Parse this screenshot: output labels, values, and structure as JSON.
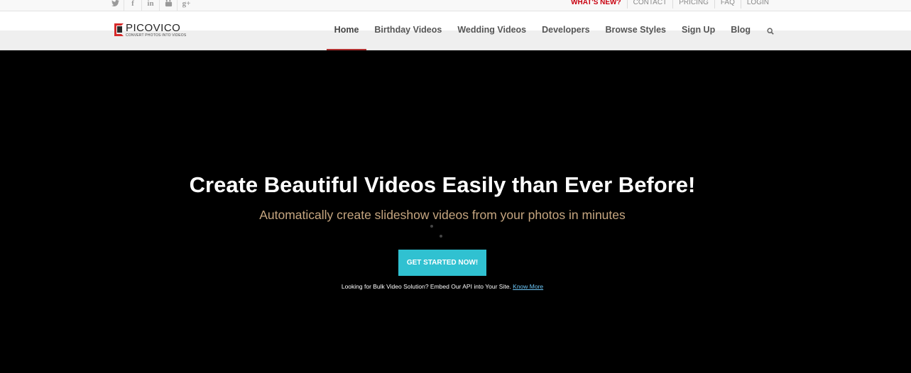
{
  "topbar": {
    "social": [
      {
        "icon": "twitter-icon",
        "glyph": "🐦"
      },
      {
        "icon": "facebook-icon",
        "glyph": "f"
      },
      {
        "icon": "linkedin-icon",
        "glyph": "in"
      },
      {
        "icon": "youtube-icon",
        "glyph": "▣"
      },
      {
        "icon": "google-plus-icon",
        "glyph": "g+"
      }
    ],
    "links": [
      "WHAT'S NEW?",
      "CONTACT",
      "PRICING",
      "FAQ",
      "LOGIN"
    ],
    "highlight_color": "#c8000f"
  },
  "logo": {
    "name": "PICOVICO",
    "tagline": "CONVERT PHOTOS INTO VIDEOS"
  },
  "nav": {
    "items": [
      "Home",
      "Birthday Videos",
      "Wedding Videos",
      "Developers",
      "Browse Styles",
      "Sign Up",
      "Blog"
    ],
    "active": "Home",
    "search_icon": "search-icon"
  },
  "hero": {
    "title": "Create Beautiful Videos Easily than Ever Before!",
    "subtitle": "Automatically create slideshow videos from your photos in minutes",
    "cta_label": "GET STARTED NOW!",
    "api_text": "Looking for Bulk Video Solution? Embed Our API into Your Site. ",
    "api_link": "Know More",
    "cta_color": "#30c1d1"
  }
}
